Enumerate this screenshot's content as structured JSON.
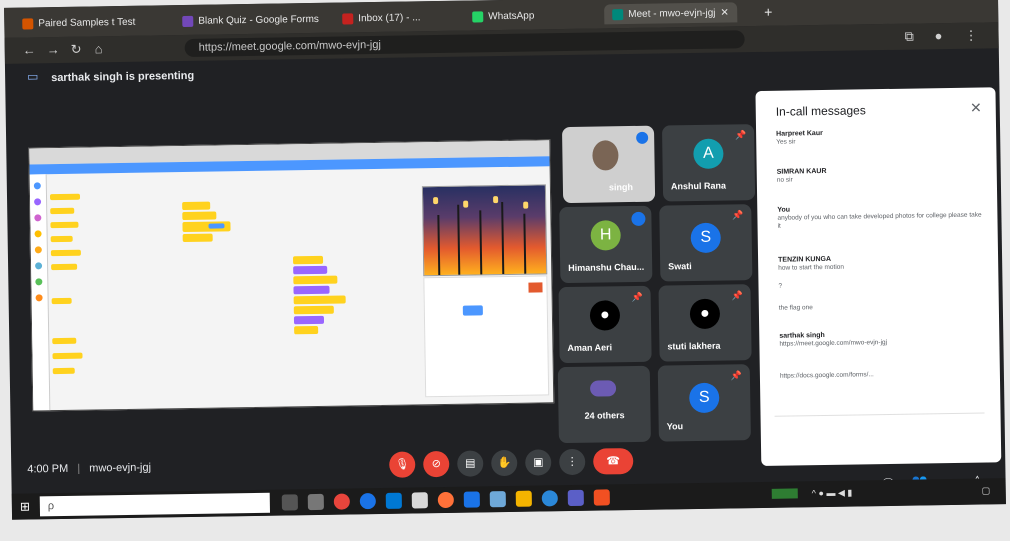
{
  "browser": {
    "tabs": [
      {
        "title": "Paired Samples t Test",
        "color": "#d35400"
      },
      {
        "title": "Blank Quiz - Google Forms",
        "color": "#7248b9"
      },
      {
        "title": "Inbox (17) - ...",
        "color": "#c5221f"
      },
      {
        "title": "WhatsApp",
        "color": "#25d366"
      },
      {
        "title": "Meet - mwo-evjn-jgj",
        "color": "#00897b"
      }
    ],
    "url": "https://meet.google.com/mwo-evjn-jgj"
  },
  "meet": {
    "presenting_text": "sarthak singh is presenting",
    "meeting_time": "4:00 PM",
    "meeting_code": "mwo-evjn-jgj",
    "participants": [
      {
        "name": "singh",
        "avatar": "",
        "color": "#5f6368"
      },
      {
        "name": "Anshul Rana",
        "avatar": "A",
        "color": "#129eaf"
      },
      {
        "name": "Himanshu Chau...",
        "avatar": "H",
        "color": "#7cb342"
      },
      {
        "name": "Swati",
        "avatar": "S",
        "color": "#1a73e8"
      },
      {
        "name": "Aman Aeri",
        "avatar": "",
        "color": "#000000"
      },
      {
        "name": "stuti lakhera",
        "avatar": "",
        "color": "#000000"
      },
      {
        "name": "24 others",
        "avatar": "",
        "color": "#3c4043"
      },
      {
        "name": "You",
        "avatar": "S",
        "color": "#1a73e8"
      }
    ]
  },
  "chat": {
    "title": "In-call messages",
    "messages": [
      {
        "sender": "Harpreet Kaur",
        "time": "",
        "text": "Yes sir"
      },
      {
        "sender": "SIMRAN KAUR",
        "time": "",
        "text": "no sir"
      },
      {
        "sender": "You",
        "time": "",
        "text": "anybody of you who can take developed photos for college please take it"
      },
      {
        "sender": "TENZIN KUNGA",
        "time": "",
        "text": "how to start the motion"
      },
      {
        "sender": "",
        "time": "",
        "text": "?"
      },
      {
        "sender": "",
        "time": "",
        "text": "the flag one"
      },
      {
        "sender": "sarthak singh",
        "time": "",
        "text": "https://meet.google.com/mwo-evjn-jgj"
      },
      {
        "sender": "",
        "time": "",
        "text": "https://docs.google.com/forms/..."
      }
    ]
  },
  "taskbar": {
    "search_placeholder": "ρ"
  }
}
